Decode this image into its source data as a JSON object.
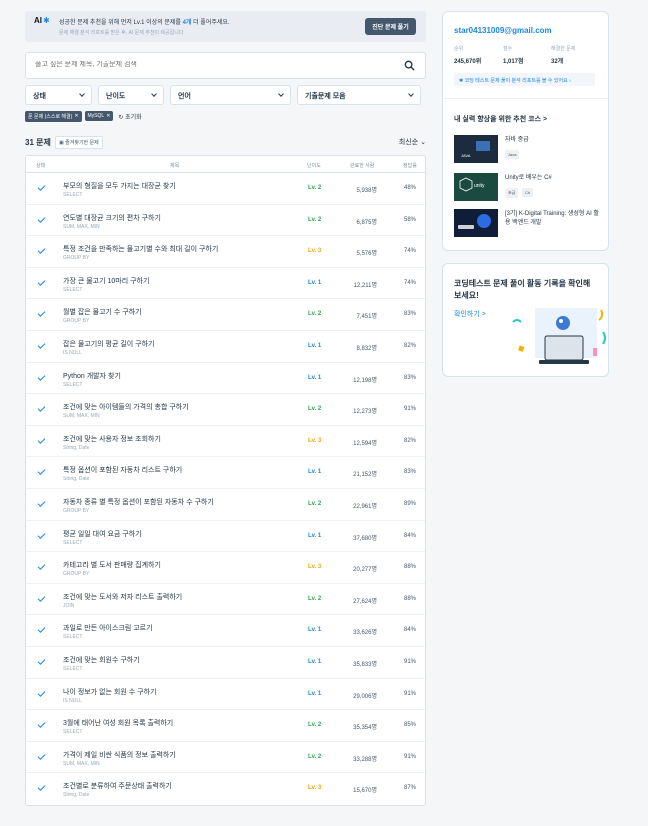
{
  "ai_banner": {
    "label": "AI",
    "text_prefix": "성공한 문제 추천을 위해 먼저 Lv.1 이상의 문제를 ",
    "text_highlight": "4개",
    "text_suffix": " 더 풀어주세요.",
    "subtext": "문제 해결 분석 리포트를 받은 후, AI 문제 추천이 제공됩니다",
    "diag_button": "진단 문제 풀기"
  },
  "search": {
    "placeholder": "풀고 싶은 문제 제목, 기출문제 검색"
  },
  "filters": [
    "상태",
    "난이도",
    "언어",
    "기출문제 모음"
  ],
  "chips": [
    "푼 문제 (스스로 해결)",
    "MySQL"
  ],
  "reset_label": "초기화",
  "count_label": "31 문제",
  "fav_label": "즐겨찾기한 문제",
  "sort_label": "최신순",
  "table_headers": {
    "status": "상태",
    "title": "제목",
    "level": "난이도",
    "solved": "완료한 사람",
    "rate": "정답률"
  },
  "colors": {
    "lv1": "#1b87e6",
    "lv2": "#2ea449",
    "lv3": "#f6a20b",
    "accent": "#1b87e6"
  },
  "problems": [
    {
      "title": "부모의 형질을 모두 가지는 대장균 찾기",
      "tag": "SELECT",
      "level": "Lv. 2",
      "solved": "5,938명",
      "rate": "48%"
    },
    {
      "title": "연도별 대장균 크기의 편차 구하기",
      "tag": "SUM, MAX, MIN",
      "level": "Lv. 2",
      "solved": "6,875명",
      "rate": "58%"
    },
    {
      "title": "특정 조건을 만족하는 물고기별 수와 최대 길이 구하기",
      "tag": "GROUP BY",
      "level": "Lv. 3",
      "solved": "5,576명",
      "rate": "74%"
    },
    {
      "title": "가장 큰 물고기 10마리 구하기",
      "tag": "SELECT",
      "level": "Lv. 1",
      "solved": "12,211명",
      "rate": "74%"
    },
    {
      "title": "월별 잡은 물고기 수 구하기",
      "tag": "GROUP BY",
      "level": "Lv. 2",
      "solved": "7,451명",
      "rate": "83%"
    },
    {
      "title": "잡은 물고기의 평균 길이 구하기",
      "tag": "IS NULL",
      "level": "Lv. 1",
      "solved": "8,832명",
      "rate": "82%"
    },
    {
      "title": "Python 개발자 찾기",
      "tag": "SELECT",
      "level": "Lv. 1",
      "solved": "12,198명",
      "rate": "83%"
    },
    {
      "title": "조건에 맞는 아이템들의 가격의 총합 구하기",
      "tag": "SUM, MAX, MIN",
      "level": "Lv. 2",
      "solved": "12,273명",
      "rate": "91%"
    },
    {
      "title": "조건에 맞는 사용자 정보 조회하기",
      "tag": "String, Date",
      "level": "Lv. 3",
      "solved": "12,594명",
      "rate": "82%"
    },
    {
      "title": "특정 옵션이 포함된 자동차 리스트 구하기",
      "tag": "String, Date",
      "level": "Lv. 1",
      "solved": "21,152명",
      "rate": "83%"
    },
    {
      "title": "자동차 종류 별 특정 옵션이 포함된 자동차 수 구하기",
      "tag": "GROUP BY",
      "level": "Lv. 2",
      "solved": "22,961명",
      "rate": "89%"
    },
    {
      "title": "평균 일일 대여 요금 구하기",
      "tag": "SELECT",
      "level": "Lv. 1",
      "solved": "37,680명",
      "rate": "84%"
    },
    {
      "title": "카테고리 별 도서 판매량 집계하기",
      "tag": "GROUP BY",
      "level": "Lv. 3",
      "solved": "20,277명",
      "rate": "88%"
    },
    {
      "title": "조건에 맞는 도서와 저자 리스트 출력하기",
      "tag": "JOIN",
      "level": "Lv. 2",
      "solved": "27,624명",
      "rate": "88%"
    },
    {
      "title": "과일로 만든 아이스크림 고르기",
      "tag": "SELECT",
      "level": "Lv. 1",
      "solved": "33,626명",
      "rate": "84%"
    },
    {
      "title": "조건에 맞는 회원수 구하기",
      "tag": "SELECT",
      "level": "Lv. 1",
      "solved": "35,833명",
      "rate": "91%"
    },
    {
      "title": "나이 정보가 없는 회원 수 구하기",
      "tag": "IS NULL",
      "level": "Lv. 1",
      "solved": "29,006명",
      "rate": "91%"
    },
    {
      "title": "3월에 태어난 여성 회원 목록 출력하기",
      "tag": "SELECT",
      "level": "Lv. 2",
      "solved": "35,354명",
      "rate": "85%"
    },
    {
      "title": "가격이 제일 비싼 식품의 정보 출력하기",
      "tag": "SUM, MAX, MIN",
      "level": "Lv. 2",
      "solved": "33,288명",
      "rate": "91%"
    },
    {
      "title": "조건별로 분류하여 주문상태 출력하기",
      "tag": "String, Date",
      "level": "Lv. 3",
      "solved": "15,670명",
      "rate": "87%"
    }
  ],
  "profile": {
    "email": "star04131009@gmail.com",
    "stats": [
      {
        "label": "순위",
        "value": "245,670위"
      },
      {
        "label": "점수",
        "value": "1,017점"
      },
      {
        "label": "해결한 문제",
        "value": "32개"
      }
    ],
    "report_link": "코딩 테스트 문제 풀이 분석 리포트를 볼 수 있어요",
    "rec_title": "내 실력 향상을 위한 추천 코스 >",
    "courses": [
      {
        "title": "자바 중급",
        "tags": [
          "Java"
        ]
      },
      {
        "title": "Unity로 배우는 C#",
        "tags": [
          "초급",
          "C#"
        ]
      },
      {
        "title": "[3기] K-Digital Training: 생성형 AI 활용 백엔드 개발",
        "tags": []
      }
    ]
  },
  "ct_card": {
    "title": "코딩테스트 문제 풀이 활동 기록을 확인해보세요!",
    "link": "확인하기 >"
  }
}
